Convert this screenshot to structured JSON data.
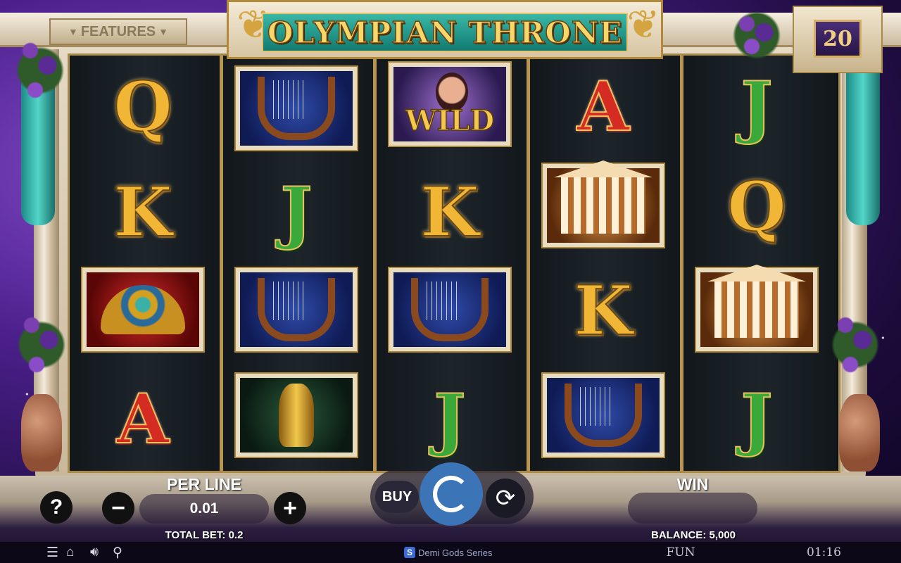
{
  "game": {
    "title": "OLYMPIAN THRONE",
    "features_label": "FEATURES",
    "lines": "20"
  },
  "reels": [
    [
      "Q",
      "K",
      "crown",
      "A"
    ],
    [
      "lyre",
      "J",
      "lyre",
      "vase"
    ],
    [
      "wild",
      "K",
      "lyre",
      "J"
    ],
    [
      "A",
      "temple",
      "K",
      "lyre"
    ],
    [
      "J",
      "Q",
      "temple",
      "J"
    ]
  ],
  "symbols": {
    "wild_label": "WILD"
  },
  "controls": {
    "help_label": "?",
    "minus_label": "−",
    "plus_label": "+",
    "per_line_label": "PER LINE",
    "per_line_value": "0.01",
    "total_bet": "TOTAL BET: 0.2",
    "buy_label": "BUY",
    "win_label": "WIN",
    "win_value": "",
    "balance": "BALANCE: 5,000"
  },
  "footer": {
    "series_logo": "S",
    "series": "Demi Gods Series",
    "mode": "FUN",
    "clock": "01:16",
    "icons": [
      "menu-icon",
      "home-icon",
      "sound-icon",
      "turbo-icon"
    ]
  }
}
